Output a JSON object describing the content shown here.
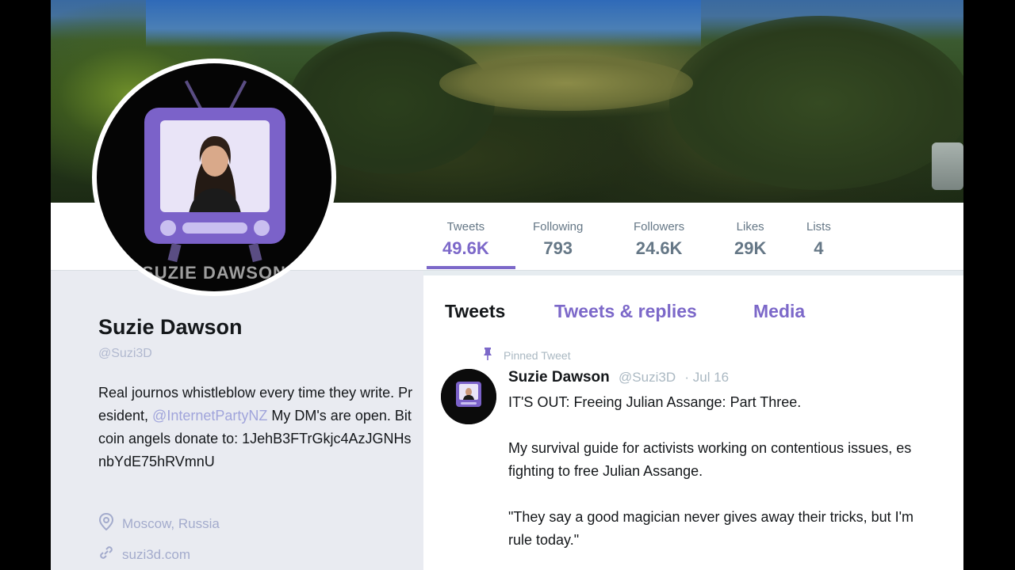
{
  "profile": {
    "display_name": "Suzie Dawson",
    "handle": "@Suzi3D",
    "bio_text": "Real journos whistleblow every time they write. President, ",
    "bio_mention": "@InternetPartyNZ",
    "bio_text_2": " My DM's are open. Bitcoin angels donate to: 1JehB3FTrGkjc4AzJGNHsnbYdE75hRVmnU",
    "location": "Moscow, Russia",
    "website": "suzi3d.com",
    "avatar_label": "SUZIE DAWSON"
  },
  "stats": [
    {
      "label": "Tweets",
      "value": "49.6K"
    },
    {
      "label": "Following",
      "value": "793"
    },
    {
      "label": "Followers",
      "value": "24.6K"
    },
    {
      "label": "Likes",
      "value": "29K"
    },
    {
      "label": "Lists",
      "value": "4"
    }
  ],
  "tabs": [
    {
      "label": "Tweets"
    },
    {
      "label": "Tweets & replies"
    },
    {
      "label": "Media"
    }
  ],
  "pinned_tweet": {
    "pinned_label": "Pinned Tweet",
    "author": "Suzie Dawson",
    "handle": "@Suzi3D",
    "date": "· Jul 16",
    "line1": "IT'S OUT: Freeing Julian Assange: Part Three.",
    "line2a": "My survival guide for activists working on contentious issues, es",
    "line2b": "fighting to free Julian Assange.",
    "line3a": "\"They say a good magician never gives away their tricks, but I'm",
    "line3b": "rule today.\""
  },
  "colors": {
    "accent": "#7c68c9",
    "text_primary": "#14171a",
    "text_secondary": "#657786"
  }
}
